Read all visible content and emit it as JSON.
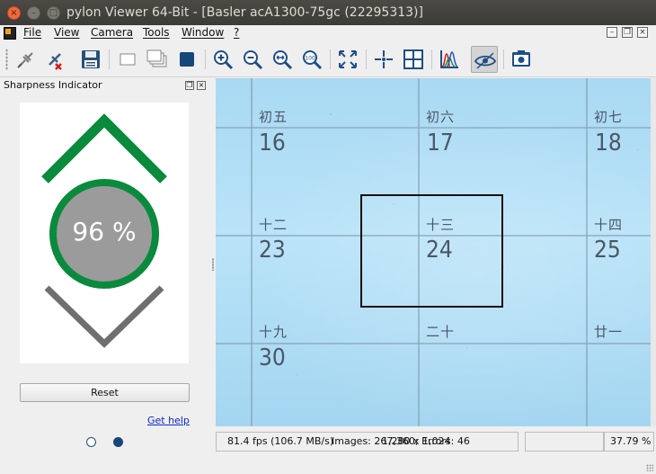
{
  "window": {
    "title": "pylon Viewer 64-Bit - [Basler acA1300-75gc (22295313)]",
    "close_glyph": "×",
    "minimize_glyph": "–",
    "maximize_glyph": "□"
  },
  "menu": {
    "items": [
      "File",
      "View",
      "Camera",
      "Tools",
      "Window",
      "?"
    ]
  },
  "mdi_controls": [
    "minimize-icon",
    "restore-icon",
    "close-icon"
  ],
  "toolbar": {
    "buttons": [
      "disconnect-device-icon",
      "connect-device-icon",
      "save-image-icon",
      "single-shot-icon",
      "continuous-shot-icon",
      "stop-grab-icon",
      "zoom-in-icon",
      "zoom-out-icon",
      "fit-to-window-icon",
      "zoom-100-icon",
      "fullscreen-icon",
      "center-crosshair-icon",
      "grid-icon",
      "histogram-icon",
      "sharpness-eye-icon",
      "image-capture-icon"
    ],
    "pressed": "sharpness-eye-icon"
  },
  "sharpness_panel": {
    "title": "Sharpness Indicator",
    "value": "96 %",
    "colors": {
      "up_chevron": "#0a8a3c",
      "ring": "#0a8a3c",
      "fill": "#9b9b9b",
      "down_chevron": "#6f6f6f"
    },
    "reset_label": "Reset",
    "help_link": "Get help",
    "page_dots": {
      "count": 2,
      "active": 2
    }
  },
  "calendar_image": {
    "row1": {
      "han": [
        "初五",
        "初六",
        "初七"
      ],
      "num": [
        "16",
        "17",
        "18"
      ]
    },
    "row2": {
      "han": [
        "十二",
        "十三",
        "十四"
      ],
      "num": [
        "23",
        "24",
        "25"
      ]
    },
    "row3": {
      "han": [
        "十九",
        "二十",
        "廿一"
      ],
      "num": [
        "30"
      ]
    }
  },
  "status_bar": {
    "fps": "81.4 fps (106.7 MB/s)",
    "images": "Images: 267,360; Errors: 46",
    "resolution_overlap": "1,280 x 1,024",
    "zoom": "37.79 %"
  }
}
